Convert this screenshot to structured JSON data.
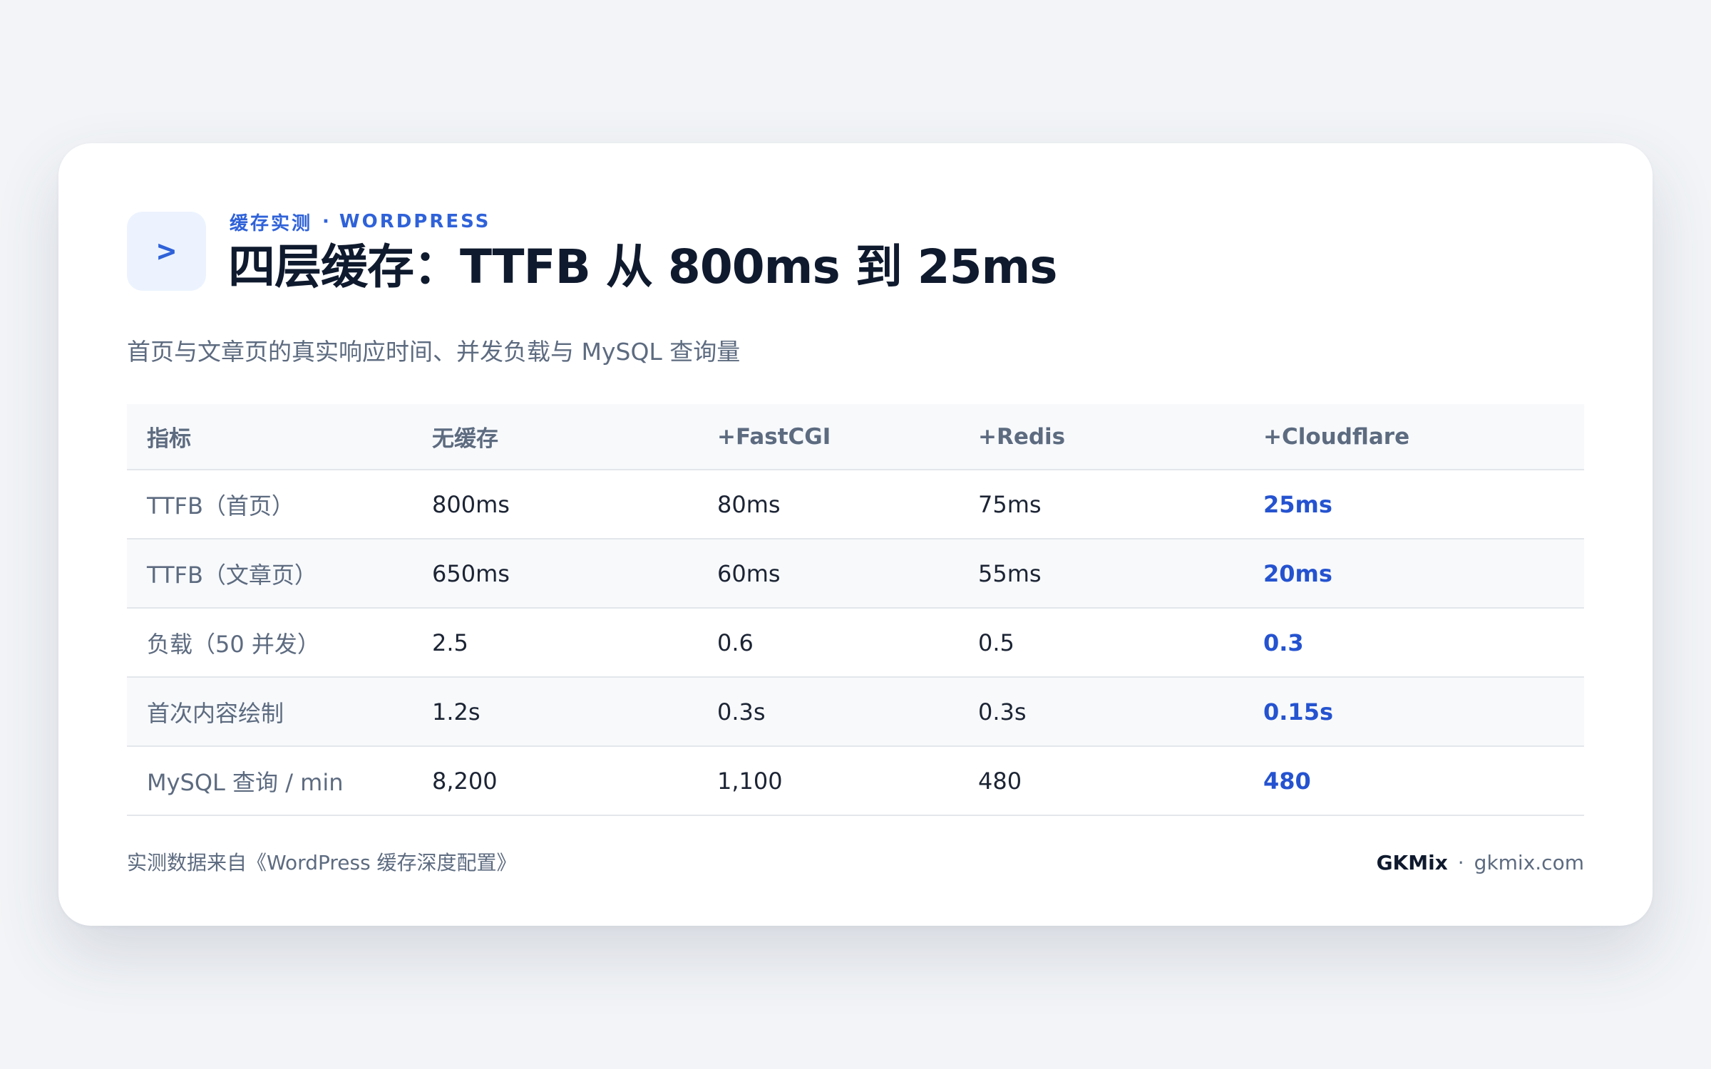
{
  "header": {
    "icon": "chevron-right-icon",
    "icon_glyph": ">",
    "eyebrow_left": "缓存实测",
    "eyebrow_sep": "·",
    "eyebrow_right": "WORDPRESS",
    "title": "四层缓存：TTFB 从 800ms 到 25ms",
    "subtitle": "首页与文章页的真实响应时间、并发负载与 MySQL 查询量"
  },
  "table": {
    "columns": [
      "指标",
      "无缓存",
      "+FastCGI",
      "+Redis",
      "+Cloudflare"
    ],
    "rows": [
      [
        "TTFB（首页）",
        "800ms",
        "80ms",
        "75ms",
        "25ms"
      ],
      [
        "TTFB（文章页）",
        "650ms",
        "60ms",
        "55ms",
        "20ms"
      ],
      [
        "负载（50 并发）",
        "2.5",
        "0.6",
        "0.5",
        "0.3"
      ],
      [
        "首次内容绘制",
        "1.2s",
        "0.3s",
        "0.3s",
        "0.15s"
      ],
      [
        "MySQL 查询 / min",
        "8,200",
        "1,100",
        "480",
        "480"
      ]
    ]
  },
  "footer": {
    "source": "实测数据来自《WordPress 缓存深度配置》",
    "brand": "GKMix",
    "sep": "·",
    "site": "gkmix.com"
  },
  "colors": {
    "accent": "#2f62d9",
    "highlight": "#2553d0",
    "title": "#0f1a2e",
    "muted": "#5d6b80",
    "background": "#f2f4f7"
  }
}
